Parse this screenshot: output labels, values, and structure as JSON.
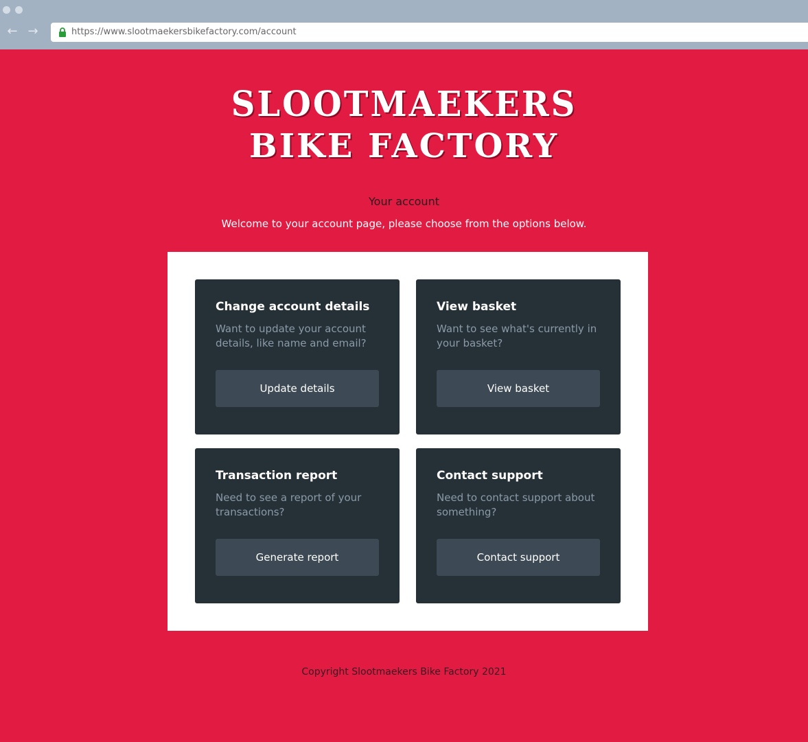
{
  "browser": {
    "url": "https://www.slootmaekersbikefactory.com/account"
  },
  "logo": {
    "line1": "SLOOTMAEKERS",
    "line2": "BIKE FACTORY"
  },
  "account": {
    "heading": "Your account",
    "welcome": "Welcome to your account page, please choose from the options below."
  },
  "cards": [
    {
      "title": "Change account details",
      "description": "Want to update your account details, like name and email?",
      "button": "Update details"
    },
    {
      "title": "View basket",
      "description": "Want to see what's currently in your basket?",
      "button": "View basket"
    },
    {
      "title": "Transaction report",
      "description": "Need to see a report of your transactions?",
      "button": "Generate report"
    },
    {
      "title": "Contact support",
      "description": "Need to contact support about something?",
      "button": "Contact support"
    }
  ],
  "footer": {
    "copyright": "Copyright Slootmaekers Bike Factory 2021"
  },
  "colors": {
    "brand": "#e11b42",
    "card": "#263037",
    "button": "#3d4a55"
  },
  "icons": [
    "back-arrow-icon",
    "forward-arrow-icon",
    "lock-icon"
  ]
}
